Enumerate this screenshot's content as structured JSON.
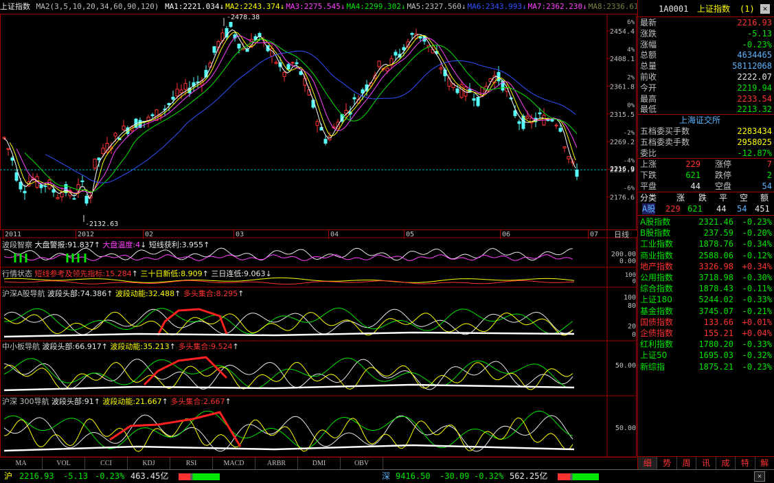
{
  "ma_bar": {
    "title": "上证指数",
    "params": "MA2(3,5,10,20,34,60,90,120)",
    "items": [
      {
        "label": "MA1:2221.034",
        "arrow": "↓",
        "color": "#ffffff"
      },
      {
        "label": "MA2:2243.374",
        "arrow": "↓",
        "color": "#ffff00"
      },
      {
        "label": "MA3:2275.545",
        "arrow": "↓",
        "color": "#ff40ff"
      },
      {
        "label": "MA4:2299.302",
        "arrow": "↓",
        "color": "#00e600"
      },
      {
        "label": "MA5:2327.560",
        "arrow": "↓",
        "color": "#c0c0c0"
      },
      {
        "label": "MA6:2343.993",
        "arrow": "↓",
        "color": "#3050ff"
      },
      {
        "label": "MA7:2362.230",
        "arrow": "↓",
        "color": "#ff40ff"
      },
      {
        "label": "MA8:2336.610",
        "arrow": "",
        "color": "#808040"
      }
    ]
  },
  "main_chart": {
    "y_ticks": [
      "2454.4",
      "2408.1",
      "2361.8",
      "2315.5",
      "2269.2",
      "2222.9",
      "2176.6"
    ],
    "pct_ticks": [
      "6%",
      "4%",
      "2%",
      "0%",
      "-2%",
      "-4%",
      "-6%"
    ],
    "high_label": "2478.38",
    "low_label": "2132.63",
    "current_label": "2216.9",
    "x_labels": [
      "2011",
      "2012",
      "02",
      "03",
      "04",
      "05",
      "06",
      "07"
    ],
    "period": "日线"
  },
  "chart_data": {
    "type": "line",
    "title": "上证指数",
    "xlabel": "",
    "ylabel": "",
    "ylim": [
      2132.63,
      2478.38
    ],
    "x": [
      "2011",
      "2012",
      "02",
      "03",
      "04",
      "05",
      "06",
      "07"
    ],
    "series": [
      {
        "name": "MA1",
        "values": [
          2250,
          2180,
          2290,
          2420,
          2300,
          2420,
          2340,
          2221
        ]
      },
      {
        "name": "MA2",
        "values": [
          2260,
          2190,
          2270,
          2400,
          2320,
          2400,
          2350,
          2243
        ]
      },
      {
        "name": "MA3",
        "values": [
          2290,
          2220,
          2250,
          2370,
          2340,
          2380,
          2360,
          2275
        ]
      },
      {
        "name": "MA4",
        "values": [
          2320,
          2250,
          2250,
          2340,
          2355,
          2370,
          2365,
          2299
        ]
      },
      {
        "name": "MA6",
        "values": [
          2380,
          2330,
          2300,
          2310,
          2340,
          2360,
          2370,
          2344
        ]
      }
    ]
  },
  "panel1": {
    "title": "波段智察",
    "a": "大盘警报:91.837",
    "b": "大盘温度:4",
    "c": "短线获利:3.955",
    "ticks": [
      "200.00",
      "0.00"
    ]
  },
  "panel2": {
    "title": "行情状态",
    "a": "短线参考及领先指标:15.284",
    "b": "三十日新低:8.909",
    "c": "三日连低:9.063",
    "ticks": [
      "100",
      "0"
    ]
  },
  "panel3": {
    "title": "沪深A股导航",
    "a": "波段头部:74.386",
    "b": "波段动能:32.488",
    "c": "多头集合:8.295",
    "ticks": [
      "100",
      "80",
      "20",
      "0"
    ]
  },
  "panel4": {
    "title": "中小板导航",
    "a": "波段头部:66.917",
    "b": "波段动能:35.213",
    "c": "多头集合:9.524",
    "ticks": [
      "50.00"
    ]
  },
  "panel5": {
    "title": "沪深 300导航",
    "a": "波段头部:91",
    "b": "波段动能:21.667",
    "c": "多头集合:2.667",
    "ticks": [
      "50.00"
    ]
  },
  "indicator_tabs": [
    "MA",
    "VOL",
    "CCI",
    "KDJ",
    "RSI",
    "MACD",
    "ARBR",
    "DMI",
    "OBV"
  ],
  "right_panel": {
    "code": "1A0001",
    "name": "上证指数",
    "suffix": "(1)",
    "quote": [
      {
        "label": "最新",
        "value": "2216.93",
        "color": "#ff3232"
      },
      {
        "label": "涨跌",
        "value": "-5.13",
        "color": "#00e600"
      },
      {
        "label": "涨幅",
        "value": "-0.23%",
        "color": "#00e600"
      },
      {
        "label": "总额",
        "value": "4634465",
        "color": "#5ab4ff"
      },
      {
        "label": "总量",
        "value": "58112068",
        "color": "#5ab4ff"
      },
      {
        "label": "前收",
        "value": "2222.07",
        "color": "#e8e8e8"
      },
      {
        "label": "今开",
        "value": "2219.94",
        "color": "#00e600"
      },
      {
        "label": "最高",
        "value": "2233.54",
        "color": "#ff3232"
      },
      {
        "label": "最低",
        "value": "2213.32",
        "color": "#00e600"
      }
    ],
    "exchange": "上海证交所",
    "orders": [
      {
        "label": "五档委买手数",
        "value": "2283434",
        "color": "#ffff00"
      },
      {
        "label": "五档委卖手数",
        "value": "2958025",
        "color": "#ffff00"
      },
      {
        "label": "委比",
        "value": "-12.87%",
        "color": "#00e600"
      }
    ],
    "breadth": [
      {
        "l1": "上涨",
        "v1": "229",
        "c1": "#ff3232",
        "l2": "涨停",
        "v2": "7",
        "c2": "#ff3232"
      },
      {
        "l1": "下跌",
        "v1": "621",
        "c1": "#00e600",
        "l2": "跌停",
        "v2": "2",
        "c2": "#00e600"
      },
      {
        "l1": "平盘",
        "v1": "44",
        "c1": "#e8e8e8",
        "l2": "空盘",
        "v2": "54",
        "c2": "#5ab4ff"
      }
    ],
    "class_header": [
      "分类",
      "涨",
      "跌",
      "平",
      "空",
      "额"
    ],
    "class_row": {
      "name": "A股",
      "up": "229",
      "down": "621",
      "flat": "44",
      "empty": "54",
      "amount": "451"
    },
    "indices": [
      {
        "name": "A股指数",
        "value": "2321.46",
        "pct": "-0.23%",
        "color": "#00e600"
      },
      {
        "name": "B股指数",
        "value": "237.59",
        "pct": "-0.20%",
        "color": "#00e600"
      },
      {
        "name": "工业指数",
        "value": "1878.76",
        "pct": "-0.34%",
        "color": "#00e600"
      },
      {
        "name": "商业指数",
        "value": "2588.06",
        "pct": "-0.12%",
        "color": "#00e600"
      },
      {
        "name": "地产指数",
        "value": "3326.98",
        "pct": "+0.34%",
        "color": "#ff3232"
      },
      {
        "name": "公用指数",
        "value": "3718.98",
        "pct": "-0.30%",
        "color": "#00e600"
      },
      {
        "name": "综合指数",
        "value": "1878.43",
        "pct": "-0.11%",
        "color": "#00e600"
      },
      {
        "name": "上证180",
        "value": "5244.02",
        "pct": "-0.33%",
        "color": "#00e600"
      },
      {
        "name": "基金指数",
        "value": "3745.07",
        "pct": "-0.21%",
        "color": "#00e600"
      },
      {
        "name": "国债指数",
        "value": "133.66",
        "pct": "+0.01%",
        "color": "#ff3232"
      },
      {
        "name": "企债指数",
        "value": "155.21",
        "pct": "+0.04%",
        "color": "#ff3232"
      },
      {
        "name": "红利指数",
        "value": "1780.20",
        "pct": "-0.33%",
        "color": "#00e600"
      },
      {
        "name": "上证50",
        "value": "1695.03",
        "pct": "-0.32%",
        "color": "#00e600"
      },
      {
        "name": "新综指",
        "value": "1875.21",
        "pct": "-0.23%",
        "color": "#00e600"
      }
    ],
    "bottom_tabs": [
      "细",
      "势",
      "周",
      "讯",
      "成",
      "特",
      "解"
    ]
  },
  "ticker": {
    "sh_label": "沪",
    "sh_price": "2216.93",
    "sh_chg": "-5.13",
    "sh_pct": "-0.23%",
    "sh_amt": "463.45亿",
    "sz_label": "深",
    "sz_price": "9416.50",
    "sz_chg": "-30.09",
    "sz_pct": "-0.32%",
    "sz_amt": "562.25亿"
  }
}
